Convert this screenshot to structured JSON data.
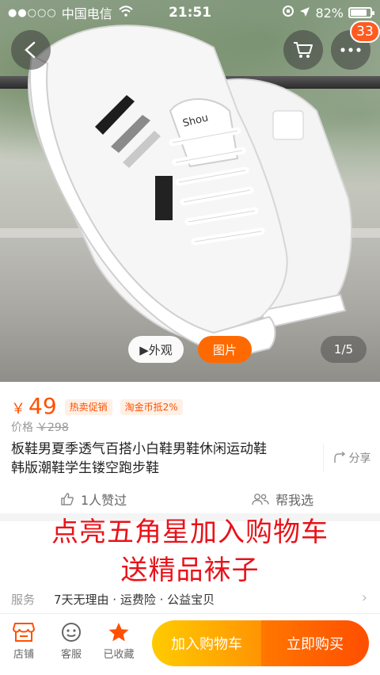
{
  "status_bar": {
    "signal": "●●○○○",
    "carrier": "中国电信",
    "time": "21:51",
    "battery_percent": "82%",
    "battery_level": 0.82
  },
  "header": {
    "cart_badge": "33"
  },
  "media": {
    "video_label": "▶外观",
    "photo_label": "图片",
    "counter": "1/5"
  },
  "product": {
    "currency": "￥",
    "price": "49",
    "tags": [
      "热卖促销",
      "淘金币抵2%"
    ],
    "orig_label": "价格",
    "orig_price": "￥298",
    "title_line1": "板鞋男夏季透气百搭小白鞋男鞋休闲运动鞋",
    "title_line2": "韩版潮鞋学生镂空跑步鞋",
    "share_label": "分享"
  },
  "social": {
    "likes": "1人赞过",
    "help_choose": "帮我选"
  },
  "promo": {
    "line1": "点亮五角星加入购物车",
    "line2": "送精品袜子",
    "color": "#e8131a"
  },
  "service": {
    "label": "服务",
    "value": "7天无理由 · 运费险 · 公益宝贝"
  },
  "bottom_bar": {
    "store": "店铺",
    "support": "客服",
    "favorited": "已收藏",
    "add_to_cart": "加入购物车",
    "buy_now": "立即购买"
  },
  "colors": {
    "accent": "#ff5000",
    "cart_gradient_start": "#ffcb00",
    "buy_gradient_end": "#ff4e00"
  }
}
